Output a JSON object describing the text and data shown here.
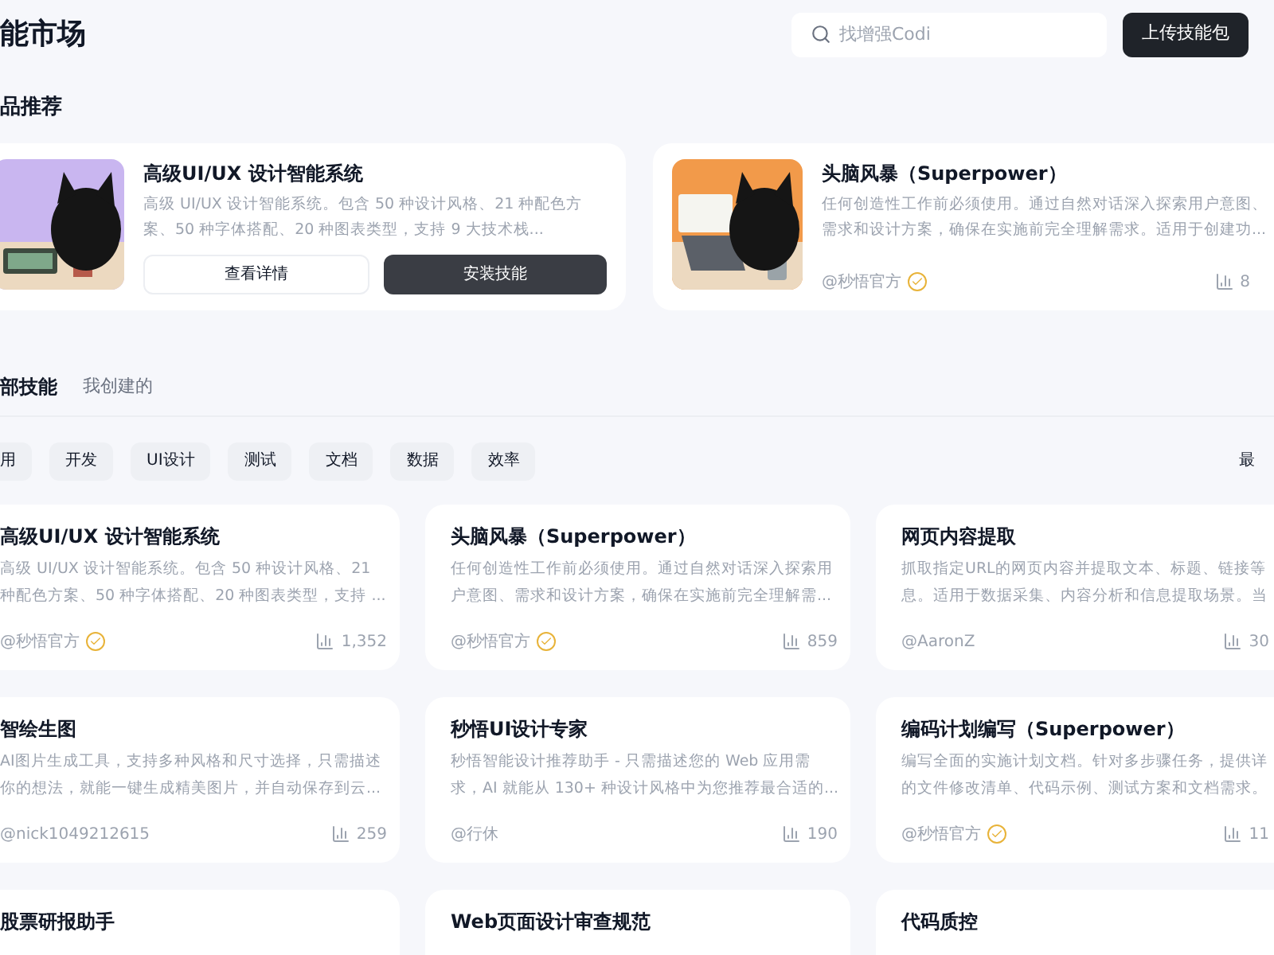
{
  "header": {
    "title": "能市场",
    "search": {
      "placeholder": "找增强Codi"
    },
    "upload_button": "上传技能包"
  },
  "featured": {
    "heading": "品推荐",
    "cards": [
      {
        "title": "高级UI/UX 设计智能系统",
        "desc_lines": [
          "高级 UI/UX 设计智能系统。包含 50 种设计风格、21 种配色方",
          "案、50 种字体搭配、20 种图表类型，支持 9 大技术栈..."
        ],
        "buttons": [
          "查看详情",
          "安装技能"
        ]
      },
      {
        "title": "头脑风暴（Superpower）",
        "desc_lines": [
          "任何创造性工作前必须使用。通过自然对话深入探索用户意图、",
          "需求和设计方案，确保在实施前完全理解需求。适用于创建功..."
        ],
        "author": "@秒悟官方",
        "verified": true,
        "stat": "8"
      }
    ]
  },
  "tabs": [
    {
      "label": "部技能",
      "selected": true
    },
    {
      "label": "我创建的",
      "selected": false
    }
  ],
  "filters": [
    {
      "label": "用",
      "selected": false
    },
    {
      "label": "开发",
      "selected": false
    },
    {
      "label": "UI设计",
      "selected": false
    },
    {
      "label": "测试",
      "selected": false
    },
    {
      "label": "文档",
      "selected": false
    },
    {
      "label": "数据",
      "selected": false
    },
    {
      "label": "效率",
      "selected": false
    }
  ],
  "sort": "最",
  "skills": [
    {
      "title": "高级UI/UX 设计智能系统",
      "desc_lines": [
        "高级 UI/UX 设计智能系统。包含 50 种设计风格、21",
        "种配色方案、50 种字体搭配、20 种图表类型，支持 ..."
      ],
      "author": "@秒悟官方",
      "verified": true,
      "stat": "1,352"
    },
    {
      "title": "头脑风暴（Superpower）",
      "desc_lines": [
        "任何创造性工作前必须使用。通过自然对话深入探索用",
        "户意图、需求和设计方案，确保在实施前完全理解需..."
      ],
      "author": "@秒悟官方",
      "verified": true,
      "stat": "859"
    },
    {
      "title": "网页内容提取",
      "desc_lines": [
        "抓取指定URL的网页内容并提取文本、标题、链接等",
        "息。适用于数据采集、内容分析和信息提取场景。当"
      ],
      "author": "@AaronZ",
      "verified": false,
      "stat": "30"
    },
    {
      "title": "智绘生图",
      "desc_lines": [
        "AI图片生成工具，支持多种风格和尺寸选择，只需描述",
        "你的想法，就能一键生成精美图片，并自动保存到云..."
      ],
      "author": "@nick1049212615",
      "verified": false,
      "stat": "259"
    },
    {
      "title": "秒悟UI设计专家",
      "desc_lines": [
        "秒悟智能设计推荐助手 - 只需描述您的 Web 应用需",
        "求，AI 就能从 130+ 种设计风格中为您推荐最合适的..."
      ],
      "author": "@行休",
      "verified": false,
      "stat": "190"
    },
    {
      "title": "编码计划编写（Superpower）",
      "desc_lines": [
        "编写全面的实施计划文档。针对多步骤任务，提供详",
        "的文件修改清单、代码示例、测试方案和文档需求。"
      ],
      "author": "@秒悟官方",
      "verified": true,
      "stat": "11"
    },
    {
      "title": "股票研报助手"
    },
    {
      "title": "Web页面设计审查规范"
    },
    {
      "title": "代码质控"
    }
  ]
}
